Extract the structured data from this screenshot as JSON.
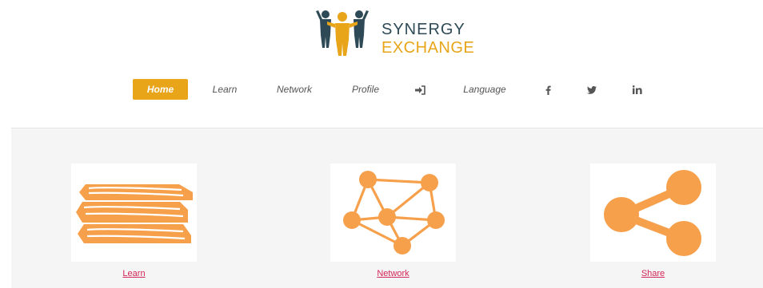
{
  "brand": {
    "line1": "SYNERGY",
    "line2": "EXCHANGE"
  },
  "nav": {
    "items": [
      {
        "label": "Home",
        "active": true
      },
      {
        "label": "Learn"
      },
      {
        "label": "Network"
      },
      {
        "label": "Profile"
      },
      {
        "label": "Language"
      }
    ],
    "icons": [
      "login-icon",
      "facebook-icon",
      "twitter-icon",
      "linkedin-icon"
    ]
  },
  "cards": [
    {
      "label": "Learn",
      "icon": "books-icon"
    },
    {
      "label": "Network",
      "icon": "network-icon"
    },
    {
      "label": "Share",
      "icon": "share-icon"
    }
  ],
  "colors": {
    "accent": "#e8a51a",
    "illustration": "#f7a04b",
    "link": "#d22659",
    "brand_dark": "#2f4a57"
  }
}
